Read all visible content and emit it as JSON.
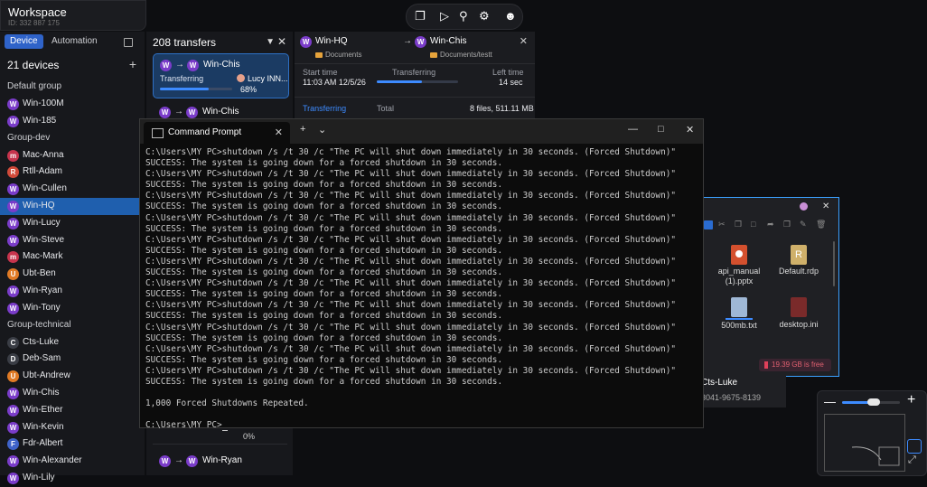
{
  "workspace": {
    "title": "Workspace",
    "id": "ID: 332 887 175"
  },
  "sidebar": {
    "tab_device": "Device",
    "tab_automation": "Automation",
    "devices_count": "21 devices",
    "groups": [
      {
        "name": "Default group",
        "items": [
          {
            "label": "Win-100M",
            "initial": "W",
            "color": "#7a3cc9"
          },
          {
            "label": "Win-185",
            "initial": "W",
            "color": "#7a3cc9"
          }
        ]
      },
      {
        "name": "Group-dev",
        "items": [
          {
            "label": "Mac-Anna",
            "initial": "m",
            "color": "#c7344d"
          },
          {
            "label": "Rtll-Adam",
            "initial": "R",
            "color": "#d14a3a"
          },
          {
            "label": "Win-Cullen",
            "initial": "W",
            "color": "#7a3cc9"
          },
          {
            "label": "Win-HQ",
            "initial": "W",
            "color": "#7a3cc9"
          },
          {
            "label": "Win-Lucy",
            "initial": "W",
            "color": "#7a3cc9"
          },
          {
            "label": "Win-Steve",
            "initial": "W",
            "color": "#7a3cc9"
          },
          {
            "label": "Mac-Mark",
            "initial": "m",
            "color": "#c7344d"
          },
          {
            "label": "Ubt-Ben",
            "initial": "U",
            "color": "#e07a25"
          },
          {
            "label": "Win-Ryan",
            "initial": "W",
            "color": "#7a3cc9"
          },
          {
            "label": "Win-Tony",
            "initial": "W",
            "color": "#7a3cc9"
          }
        ]
      },
      {
        "name": "Group-technical",
        "items": [
          {
            "label": "Cts-Luke",
            "initial": "C",
            "color": "#3a3d45"
          },
          {
            "label": "Deb-Sam",
            "initial": "D",
            "color": "#3a3d45"
          },
          {
            "label": "Ubt-Andrew",
            "initial": "U",
            "color": "#e07a25"
          },
          {
            "label": "Win-Chis",
            "initial": "W",
            "color": "#7a3cc9"
          },
          {
            "label": "Win-Ether",
            "initial": "W",
            "color": "#7a3cc9"
          },
          {
            "label": "Win-Kevin",
            "initial": "W",
            "color": "#7a3cc9"
          },
          {
            "label": "Fdr-Albert",
            "initial": "F",
            "color": "#3f63c9"
          },
          {
            "label": "Win-Alexander",
            "initial": "W",
            "color": "#7a3cc9"
          },
          {
            "label": "Win-Lily",
            "initial": "W",
            "color": "#7a3cc9"
          }
        ]
      }
    ]
  },
  "transfers": {
    "header": "208 transfers",
    "active": {
      "target": "Win-Chis",
      "status": "Transferring",
      "user": "Lucy INN...",
      "percent": "68%",
      "progress": 0.68
    },
    "second": {
      "target": "Win-Chis"
    },
    "bottom_percent": "0%",
    "last": {
      "target": "Win-Ryan"
    },
    "initial": "W"
  },
  "detail": {
    "source": "Win-HQ",
    "source_folder": "Documents",
    "target": "Win-Chis",
    "target_folder": "Documents/testt",
    "start_label": "Start time",
    "start_value": "11:03 AM 12/5/26",
    "status_label": "Transferring",
    "left_label": "Left time",
    "left_value": "14 sec",
    "progress": 0.55,
    "tab_transferring": "Transferring",
    "total_label": "Total",
    "total_value": "8 files, 511.11 MB"
  },
  "files": {
    "items": [
      {
        "name": "api_manual (1).pptx"
      },
      {
        "name": "Default.rdp"
      },
      {
        "name": "500mb.txt"
      },
      {
        "name": "desktop.ini"
      }
    ],
    "free_space": "19.39 GB is free"
  },
  "device_card": {
    "name": "Cts-Luke",
    "id": "3041-9675-8139"
  },
  "cmd": {
    "tab_title": "Command Prompt",
    "lines": [
      "C:\\Users\\MY PC>shutdown /s /t 30 /c \"The PC will shut down immediately in 30 seconds. (Forced Shutdown)\"",
      "SUCCESS: The system is going down for a forced shutdown in 30 seconds.",
      "C:\\Users\\MY PC>shutdown /s /t 30 /c \"The PC will shut down immediately in 30 seconds. (Forced Shutdown)\"",
      "SUCCESS: The system is going down for a forced shutdown in 30 seconds.",
      "C:\\Users\\MY PC>shutdown /s /t 30 /c \"The PC will shut down immediately in 30 seconds. (Forced Shutdown)\"",
      "SUCCESS: The system is going down for a forced shutdown in 30 seconds.",
      "C:\\Users\\MY PC>shutdown /s /t 30 /c \"The PC will shut down immediately in 30 seconds. (Forced Shutdown)\"",
      "SUCCESS: The system is going down for a forced shutdown in 30 seconds.",
      "C:\\Users\\MY PC>shutdown /s /t 30 /c \"The PC will shut down immediately in 30 seconds. (Forced Shutdown)\"",
      "SUCCESS: The system is going down for a forced shutdown in 30 seconds.",
      "C:\\Users\\MY PC>shutdown /s /t 30 /c \"The PC will shut down immediately in 30 seconds. (Forced Shutdown)\"",
      "SUCCESS: The system is going down for a forced shutdown in 30 seconds.",
      "C:\\Users\\MY PC>shutdown /s /t 30 /c \"The PC will shut down immediately in 30 seconds. (Forced Shutdown)\"",
      "SUCCESS: The system is going down for a forced shutdown in 30 seconds.",
      "C:\\Users\\MY PC>shutdown /s /t 30 /c \"The PC will shut down immediately in 30 seconds. (Forced Shutdown)\"",
      "SUCCESS: The system is going down for a forced shutdown in 30 seconds.",
      "C:\\Users\\MY PC>shutdown /s /t 30 /c \"The PC will shut down immediately in 30 seconds. (Forced Shutdown)\"",
      "SUCCESS: The system is going down for a forced shutdown in 30 seconds.",
      "C:\\Users\\MY PC>shutdown /s /t 30 /c \"The PC will shut down immediately in 30 seconds. (Forced Shutdown)\"",
      "SUCCESS: The system is going down for a forced shutdown in 30 seconds.",
      "C:\\Users\\MY PC>shutdown /s /t 30 /c \"The PC will shut down immediately in 30 seconds. (Forced Shutdown)\"",
      "SUCCESS: The system is going down for a forced shutdown in 30 seconds.",
      "",
      "1,000 Forced Shutdowns Repeated.",
      "",
      "C:\\Users\\MY PC>"
    ]
  },
  "zoom": {
    "level": 0.55
  }
}
